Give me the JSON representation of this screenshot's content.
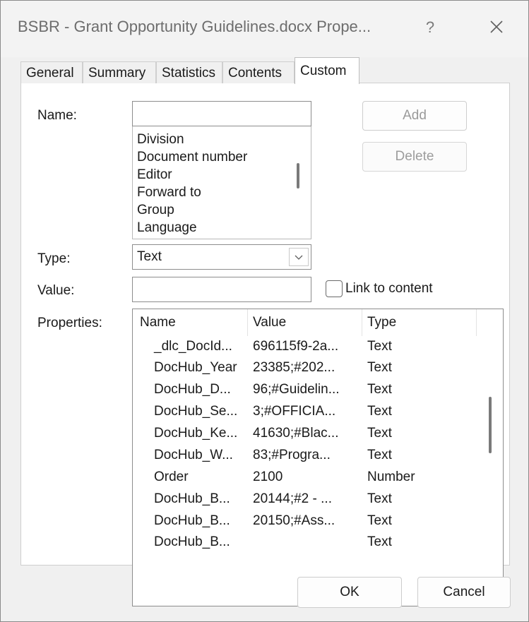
{
  "window": {
    "title": "BSBR - Grant Opportunity Guidelines.docx Prope...",
    "help_label": "?",
    "close_icon": "close-icon"
  },
  "tabs": [
    {
      "label": "General"
    },
    {
      "label": "Summary"
    },
    {
      "label": "Statistics"
    },
    {
      "label": "Contents"
    },
    {
      "label": "Custom",
      "active": true
    }
  ],
  "form": {
    "name_label": "Name:",
    "name_value": "",
    "name_options": [
      "Division",
      "Document number",
      "Editor",
      "Forward to",
      "Group",
      "Language"
    ],
    "add_label": "Add",
    "delete_label": "Delete",
    "type_label": "Type:",
    "type_value": "Text",
    "value_label": "Value:",
    "value_value": "",
    "link_label": "Link to content",
    "link_checked": false,
    "properties_label": "Properties:"
  },
  "properties": {
    "columns": [
      "Name",
      "Value",
      "Type"
    ],
    "rows": [
      {
        "name": "_dlc_DocId...",
        "value": "696115f9-2a...",
        "type": "Text"
      },
      {
        "name": "DocHub_Year",
        "value": "23385;#202...",
        "type": "Text"
      },
      {
        "name": "DocHub_D...",
        "value": "96;#Guidelin...",
        "type": "Text"
      },
      {
        "name": "DocHub_Se...",
        "value": "3;#OFFICIA...",
        "type": "Text"
      },
      {
        "name": "DocHub_Ke...",
        "value": "41630;#Blac...",
        "type": "Text"
      },
      {
        "name": "DocHub_W...",
        "value": "83;#Progra...",
        "type": "Text"
      },
      {
        "name": "Order",
        "value": "2100",
        "type": "Number"
      },
      {
        "name": "DocHub_B...",
        "value": "20144;#2 - ...",
        "type": "Text"
      },
      {
        "name": "DocHub_B...",
        "value": "20150;#Ass...",
        "type": "Text"
      },
      {
        "name": "DocHub_B...",
        "value": "",
        "type": "Text"
      }
    ]
  },
  "footer": {
    "ok_label": "OK",
    "cancel_label": "Cancel"
  }
}
